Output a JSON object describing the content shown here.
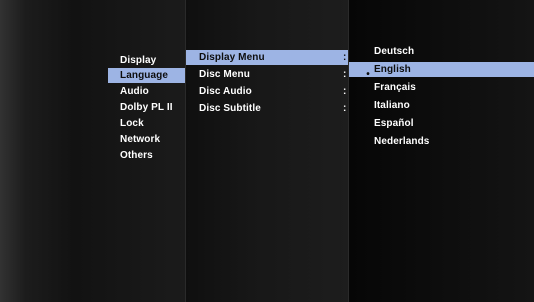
{
  "menu": {
    "categories": [
      "Display",
      "Language",
      "Audio",
      "Dolby PL II",
      "Lock",
      "Network",
      "Others"
    ],
    "selected_category": "Language",
    "submenu": [
      {
        "label": "Display Menu",
        "separator": ":"
      },
      {
        "label": "Disc Menu",
        "separator": ":"
      },
      {
        "label": "Disc Audio",
        "separator": ":"
      },
      {
        "label": "Disc Subtitle",
        "separator": ":"
      }
    ],
    "selected_submenu": "Display Menu",
    "options": [
      "Deutsch",
      "English",
      "Français",
      "Italiano",
      "Español",
      "Nederlands"
    ],
    "selected_option": "English",
    "selected_marker": "•"
  },
  "colors": {
    "highlight": "#9db4e4",
    "text": "#ffffff",
    "selected_text": "#0d0d0d",
    "background": "#141414"
  },
  "icons": {
    "selected_marker": "bullet-dot-icon"
  }
}
